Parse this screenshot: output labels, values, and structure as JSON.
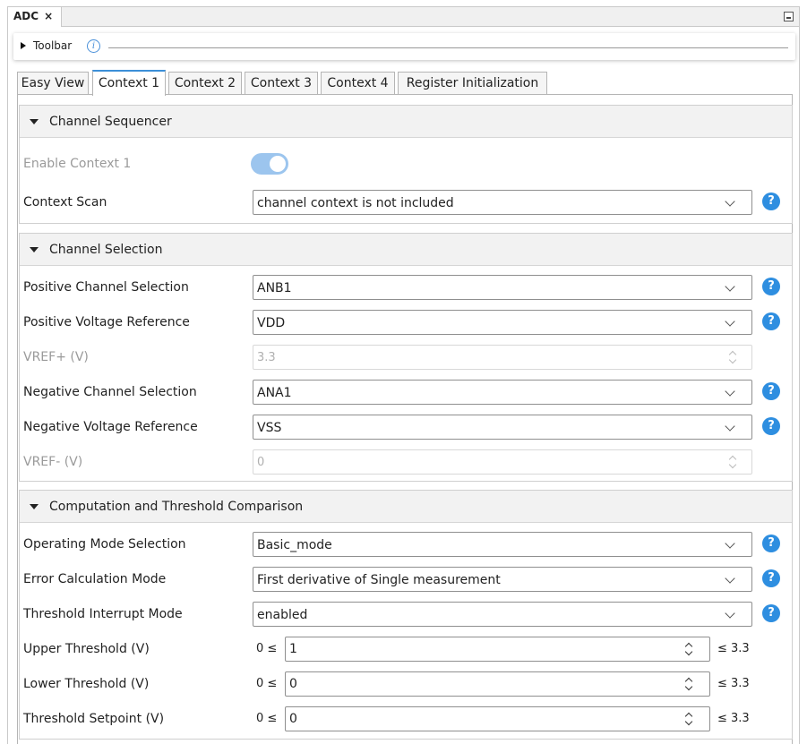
{
  "window": {
    "tab_label": "ADC",
    "close_glyph": "×"
  },
  "toolbar": {
    "label": "Toolbar",
    "info_glyph": "i"
  },
  "tabs": [
    {
      "label": "Easy View"
    },
    {
      "label": "Context 1",
      "active": true
    },
    {
      "label": "Context 2"
    },
    {
      "label": "Context 3"
    },
    {
      "label": "Context 4"
    },
    {
      "label": "Register Initialization"
    }
  ],
  "sections": {
    "sequencer": {
      "title": "Channel Sequencer",
      "enable_label": "Enable Context 1",
      "enable_value": true,
      "scan_label": "Context Scan",
      "scan_value": "channel context is not included"
    },
    "selection": {
      "title": "Channel Selection",
      "pos_channel_label": "Positive Channel Selection",
      "pos_channel_value": "ANB1",
      "pos_ref_label": "Positive Voltage Reference",
      "pos_ref_value": "VDD",
      "vref_plus_label": "VREF+ (V)",
      "vref_plus_value": "3.3",
      "neg_channel_label": "Negative Channel Selection",
      "neg_channel_value": "ANA1",
      "neg_ref_label": "Negative Voltage Reference",
      "neg_ref_value": "VSS",
      "vref_minus_label": "VREF- (V)",
      "vref_minus_value": "0"
    },
    "computation": {
      "title": "Computation and Threshold Comparison",
      "op_mode_label": "Operating Mode Selection",
      "op_mode_value": "Basic_mode",
      "err_calc_label": "Error Calculation Mode",
      "err_calc_value": "First derivative of Single measurement",
      "thr_int_label": "Threshold Interrupt Mode",
      "thr_int_value": "enabled",
      "upper_label": "Upper Threshold (V)",
      "upper_value": "1",
      "lower_label": "Lower Threshold (V)",
      "lower_value": "0",
      "setpoint_label": "Threshold Setpoint (V)",
      "setpoint_value": "0",
      "range_min": "0 ≤",
      "range_max": "≤ 3.3"
    }
  },
  "help_glyph": "?",
  "colors": {
    "accent": "#2e8ee0",
    "toggle_on": "#9cc5ee"
  }
}
